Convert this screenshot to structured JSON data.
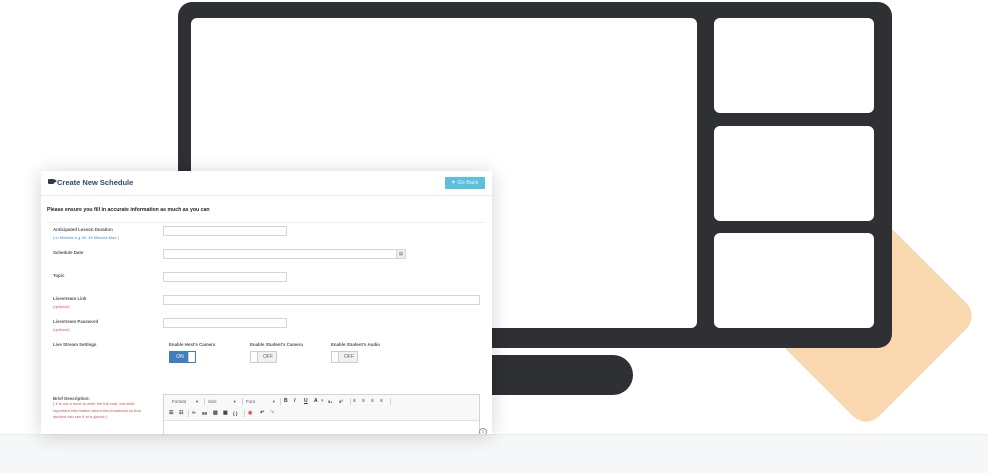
{
  "form": {
    "title": "Create New Schedule",
    "go_back_label": "Go Back",
    "intro_text": "Please ensure you fill in accurate information as much as you can",
    "fields": {
      "duration": {
        "label": "Anticipated Lesson Duration",
        "hint": "( in Minutes e.g 30, 45 Minutes Max )",
        "value": ""
      },
      "date": {
        "label": "Schedule Date",
        "value": ""
      },
      "topic": {
        "label": "Topic",
        "value": ""
      },
      "link": {
        "label": "Livestream Link",
        "hint": "(optional)",
        "value": ""
      },
      "password": {
        "label": "Livestream Password",
        "hint": "(optional)",
        "value": ""
      }
    },
    "settings": {
      "label": "Live Stream Settings",
      "toggles": [
        {
          "label": "Enable Host's Camera",
          "state": "ON"
        },
        {
          "label": "Enable Student's Camera",
          "state": "OFF"
        },
        {
          "label": "Enable Student's Audio",
          "state": "OFF"
        }
      ]
    },
    "brief": {
      "label": "Brief Description:",
      "hint": "( It is not a must to write the full note, but write important information about this broadcast so that student can see it at a glance )"
    },
    "editor": {
      "format_label": "Format",
      "size_label": "Size",
      "font_label": "Font",
      "bold": "B",
      "italic": "I",
      "underline": "U",
      "text_color": "A",
      "subscript": "x₂",
      "superscript": "x²",
      "align_left": "≡",
      "align_center": "≡",
      "align_right": "≡",
      "justify": "≡",
      "bullet_list": "☰",
      "numbered_list": "☷",
      "link": "∞",
      "blockquote": "99",
      "image": "▨",
      "table": "▦",
      "source": "{ }",
      "special": "◉",
      "undo": "↶",
      "redo": "↷"
    }
  },
  "colors": {
    "accent": "#5bc0de",
    "title": "#2b4a6f",
    "hint_red": "#d9534f",
    "toggle_on": "#3f7fbf",
    "monitor": "#2e3033",
    "diamond": "#f9d8b0"
  }
}
